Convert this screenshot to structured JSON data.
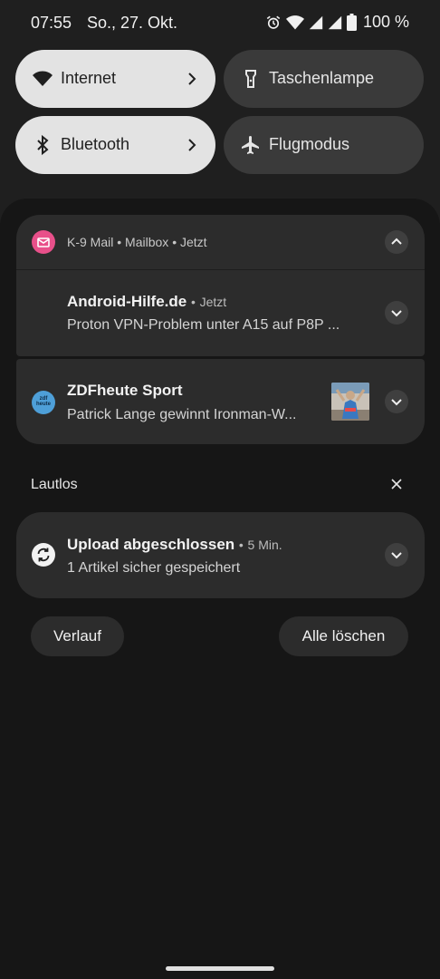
{
  "status_bar": {
    "time": "07:55",
    "date": "So., 27. Okt.",
    "battery": "100 %",
    "icons": [
      "alarm-icon",
      "wifi-icon",
      "signal-icon",
      "signal-icon",
      "battery-icon"
    ]
  },
  "quick_settings": {
    "internet": {
      "label": "Internet",
      "icon": "wifi-icon",
      "state": "on"
    },
    "flashlight": {
      "label": "Taschenlampe",
      "icon": "flashlight-icon",
      "state": "off"
    },
    "bluetooth": {
      "label": "Bluetooth",
      "icon": "bluetooth-icon",
      "state": "on"
    },
    "airplane": {
      "label": "Flugmodus",
      "icon": "airplane-icon",
      "state": "off"
    }
  },
  "notifications": {
    "k9_group": {
      "app": "K-9 Mail",
      "sep1": "•",
      "account": "Mailbox",
      "sep2": "•",
      "time": "Jetzt",
      "accent": "#e8508a",
      "child": {
        "title": "Android-Hilfe.de",
        "sep": "•",
        "time": "Jetzt",
        "text": "Proton VPN-Problem unter A15 auf P8P ..."
      }
    },
    "zdf": {
      "title": "ZDFheute Sport",
      "text": "Patrick Lange gewinnt Ironman-W...",
      "icon_text_1": "zdf",
      "icon_text_2": "heute",
      "accent": "#4e9fd8"
    }
  },
  "silent_section": {
    "label": "Lautlos",
    "upload": {
      "title": "Upload abgeschlossen",
      "sep": "•",
      "time": "5 Min.",
      "text": "1 Artikel sicher gespeichert"
    }
  },
  "footer": {
    "history_label": "Verlauf",
    "clear_all_label": "Alle löschen"
  },
  "colors": {
    "background": "#1f1f1f",
    "card": "#2c2c2c",
    "tile_on": "#e3e3e3",
    "tile_off": "#3a3a3a"
  }
}
